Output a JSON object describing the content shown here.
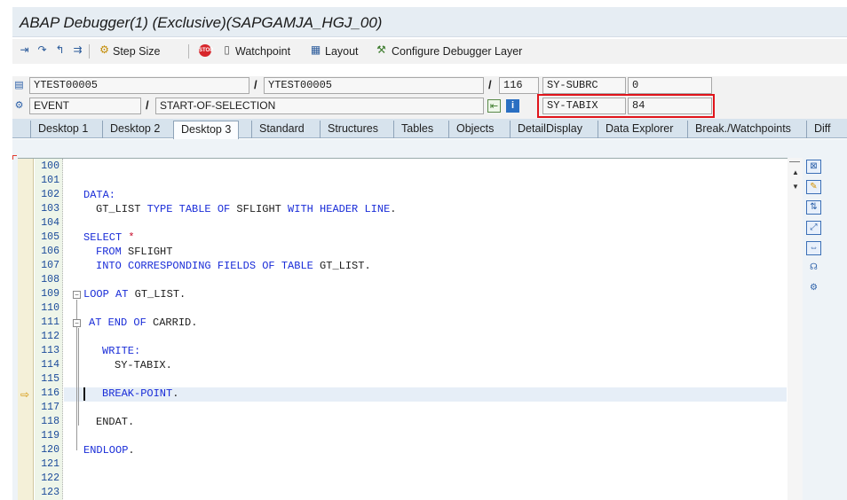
{
  "window": {
    "title": "ABAP Debugger(1)  (Exclusive)(SAPGAMJA_HGJ_00)"
  },
  "toolbar": {
    "step_size": "Step Size",
    "watchpoint": "Watchpoint",
    "layout": "Layout",
    "configure": "Configure Debugger Layer",
    "stop_label": "STOP"
  },
  "vars": {
    "program": "YTEST00005",
    "include": "YTEST00005",
    "line": "116",
    "event_type": "EVENT",
    "event_name": "START-OF-SELECTION",
    "sy_subrc_label": "SY-SUBRC",
    "sy_subrc_value": "0",
    "sy_tabix_label": "SY-TABIX",
    "sy_tabix_value": "84"
  },
  "tabs": [
    "Desktop 1",
    "Desktop 2",
    "Desktop 3",
    "Standard",
    "Structures",
    "Tables",
    "Objects",
    "DetailDisplay",
    "Data Explorer",
    "Break./Watchpoints",
    "Diff"
  ],
  "active_tab": "Desktop 3",
  "colors": {
    "accent": "#1a2dd8",
    "highlight": "#e0141b",
    "current_line": "#e6eef7"
  },
  "code": {
    "line_numbers": [
      "100",
      "101",
      "102",
      "103",
      "104",
      "105",
      "106",
      "107",
      "108",
      "109",
      "110",
      "111",
      "112",
      "113",
      "114",
      "115",
      "116",
      "117",
      "118",
      "119",
      "120",
      "121",
      "122",
      "123"
    ],
    "current_line": "116"
  },
  "icons": [
    "step-into-icon",
    "step-over-icon",
    "return-icon",
    "continue-icon",
    "step-size-icon",
    "stop-icon",
    "watchpoint-icon",
    "layout-icon",
    "configure-layer-icon",
    "program-icon",
    "event-icon",
    "navigate-icon",
    "info-icon",
    "close-tool-icon",
    "new-tool-icon",
    "replace-tool-icon",
    "maximize-icon",
    "swap-icon",
    "services-icon",
    "settings-icon"
  ]
}
